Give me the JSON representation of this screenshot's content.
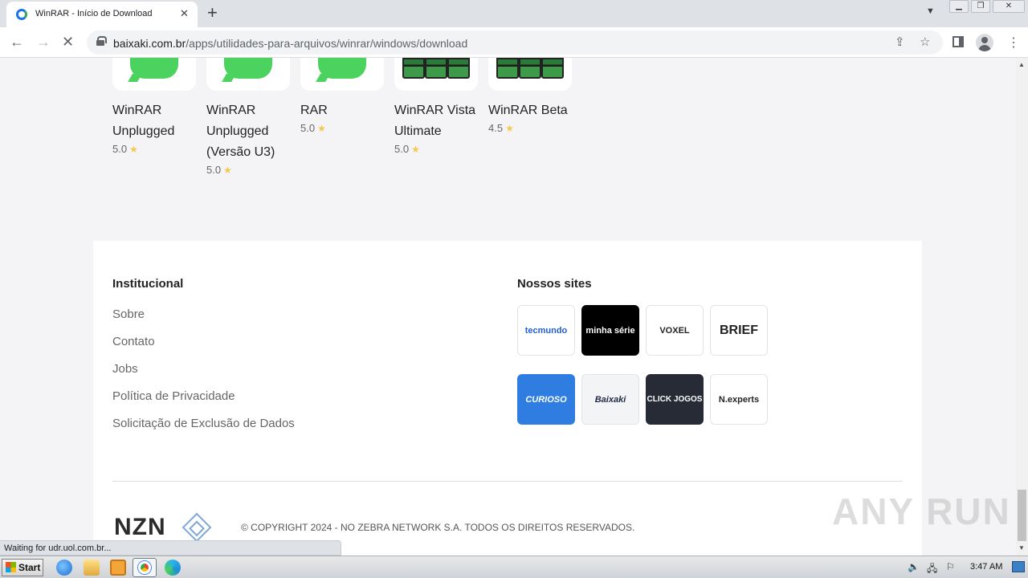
{
  "browser": {
    "tab_title": "WinRAR - Início de Download",
    "url_domain": "baixaki.com.br",
    "url_path": "/apps/utilidades-para-arquivos/winrar/windows/download",
    "status_text": "Waiting for udr.uol.com.br..."
  },
  "related_apps": [
    {
      "name": "WinRAR Unplugged",
      "rating": "5.0",
      "icon": "speech-bubble-icon"
    },
    {
      "name": "WinRAR Unplugged (Versão U3)",
      "rating": "5.0",
      "icon": "speech-bubble-icon"
    },
    {
      "name": "RAR",
      "rating": "5.0",
      "icon": "speech-bubble-icon"
    },
    {
      "name": "WinRAR Vista Ultimate",
      "rating": "5.0",
      "icon": "winrar-books-icon"
    },
    {
      "name": "WinRAR Beta",
      "rating": "4.5",
      "icon": "winrar-books-icon"
    }
  ],
  "footer": {
    "institucional_title": "Institucional",
    "institucional_links": [
      "Sobre",
      "Contato",
      "Jobs",
      "Política de Privacidade",
      "Solicitação de Exclusão de Dados"
    ],
    "sites_title": "Nossos sites",
    "sites": [
      {
        "label": "tecmundo",
        "bg": "#ffffff",
        "color": "#1f5fd6"
      },
      {
        "label": "minha série",
        "bg": "#000000",
        "color": "#ffffff"
      },
      {
        "label": "VOXEL",
        "bg": "#ffffff",
        "color": "#222222"
      },
      {
        "label": "BRIEF",
        "bg": "#ffffff",
        "color": "#222222"
      },
      {
        "label": "CURIOSO",
        "bg": "#2f7de1",
        "color": "#ffffff"
      },
      {
        "label": "Baixaki",
        "bg": "#f3f4f6",
        "color": "#1f2a44"
      },
      {
        "label": "CLICK JOGOS",
        "bg": "#262b36",
        "color": "#ffffff"
      },
      {
        "label": "N.experts",
        "bg": "#ffffff",
        "color": "#222222"
      }
    ],
    "brand": "NZN",
    "copyright": "© COPYRIGHT 2024 - NO ZEBRA NETWORK S.A. TODOS OS DIREITOS RESERVADOS."
  },
  "watermark": "ANY RUN",
  "taskbar": {
    "start_label": "Start",
    "clock": "3:47 AM"
  }
}
